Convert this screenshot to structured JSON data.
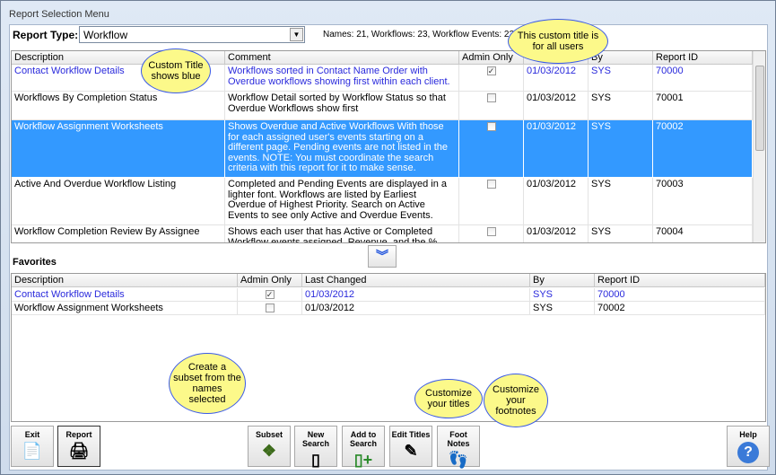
{
  "window": {
    "title": "Report Selection Menu"
  },
  "report_type": {
    "label": "Report Type:",
    "value": "Workflow"
  },
  "counts": "Names: 21, Workflows: 23, Workflow Events: 223",
  "reports": {
    "columns": [
      "Description",
      "Comment",
      "Admin Only",
      "",
      "By",
      "Report ID"
    ],
    "rows": [
      {
        "description": "Contact Workflow Details",
        "comment": "Workflows sorted in Contact Name Order with Overdue workflows showing first within each client.",
        "admin_only": true,
        "last_changed": "01/03/2012",
        "by": "SYS",
        "report_id": "70000",
        "custom": true
      },
      {
        "description": "Workflows By Completion Status",
        "comment": "Workflow Detail sorted by Workflow Status so that Overdue Workflows show first",
        "admin_only": false,
        "last_changed": "01/03/2012",
        "by": "SYS",
        "report_id": "70001"
      },
      {
        "description": "Workflow Assignment Worksheets",
        "comment": "Shows Overdue and Active Workflows With those for each assigned user's events starting on a different page. Pending events are not listed in the events. NOTE: You must coordinate the search criteria with this report for it to make sense.",
        "admin_only": false,
        "last_changed": "01/03/2012",
        "by": "SYS",
        "report_id": "70002",
        "selected": true
      },
      {
        "description": "Active And Overdue Workflow Listing",
        "comment": "Completed and Pending Events are displayed in a lighter font.  Workflows are listed by Earliest Overdue of Highest Priority.  Search on Active Events to see only Active and Overdue Events.",
        "admin_only": false,
        "last_changed": "01/03/2012",
        "by": "SYS",
        "report_id": "70003"
      },
      {
        "description": "Workflow Completion Review By Assignee",
        "comment": "Shows each user that has Active or Completed Workflow events assigned, Revenue, and the % Completed or",
        "admin_only": false,
        "last_changed": "01/03/2012",
        "by": "SYS",
        "report_id": "70004"
      }
    ]
  },
  "favorites": {
    "label": "Favorites",
    "columns": [
      "Description",
      "Admin Only",
      "Last Changed",
      "By",
      "Report ID"
    ],
    "rows": [
      {
        "description": "Contact Workflow Details",
        "admin_only": true,
        "last_changed": "01/03/2012",
        "by": "SYS",
        "report_id": "70000",
        "custom": true
      },
      {
        "description": "Workflow Assignment Worksheets",
        "admin_only": false,
        "last_changed": "01/03/2012",
        "by": "SYS",
        "report_id": "70002"
      }
    ]
  },
  "buttons": {
    "exit": "Exit",
    "report": "Report",
    "subset": "Subset",
    "new_search": "New Search",
    "add_to_search": "Add to Search",
    "edit_titles": "Edit Titles",
    "foot_notes": "Foot Notes",
    "help": "Help"
  },
  "callouts": {
    "custom_title": "Custom Title shows blue",
    "all_users": "This custom title is for all users",
    "subset": "Create a subset from the names selected",
    "titles": "Customize your titles",
    "footnotes": "Customize your footnotes"
  },
  "colors": {
    "custom_title": "#2a2adc",
    "selected_row": "#3399ff",
    "callout": "#fcf98a"
  }
}
